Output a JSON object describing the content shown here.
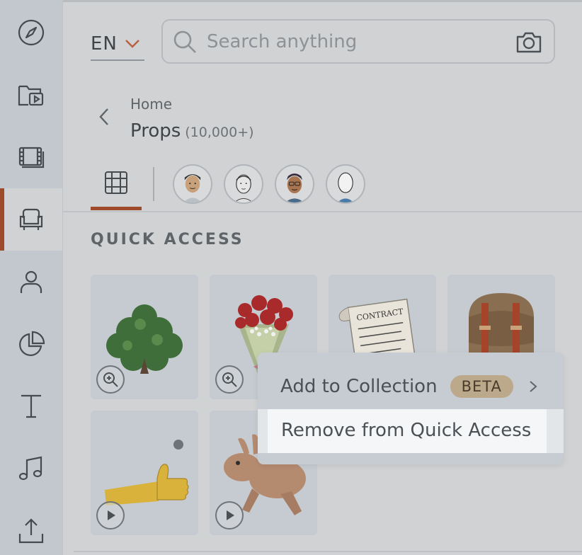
{
  "language": {
    "code": "EN"
  },
  "search": {
    "placeholder": "Search anything"
  },
  "breadcrumb": {
    "parent": "Home",
    "title": "Props",
    "count": "(10,000+)"
  },
  "section": {
    "title": "QUICK ACCESS"
  },
  "rail": {
    "items": [
      {
        "icon": "compass-icon"
      },
      {
        "icon": "folder-video-icon"
      },
      {
        "icon": "film-icon"
      },
      {
        "icon": "armchair-icon",
        "active": true
      },
      {
        "icon": "person-icon"
      },
      {
        "icon": "pie-chart-icon"
      },
      {
        "icon": "text-icon"
      },
      {
        "icon": "music-icon"
      },
      {
        "icon": "upload-icon"
      }
    ]
  },
  "tiles": [
    {
      "name": "bush",
      "badge": "zoom-icon"
    },
    {
      "name": "flower-bouquet",
      "badge": "zoom-icon"
    },
    {
      "name": "contract",
      "text": "CONTRACT"
    },
    {
      "name": "backpack"
    },
    {
      "name": "thumbs-up-hand",
      "badge": "play-icon"
    },
    {
      "name": "rabbit",
      "badge": "play-icon"
    }
  ],
  "context_menu": {
    "add_to_collection": "Add to Collection",
    "beta": "BETA",
    "remove": "Remove from Quick Access"
  },
  "colors": {
    "accent": "#a04a2c",
    "rail": "#c2c8ce",
    "background": "#d0d2d4"
  }
}
